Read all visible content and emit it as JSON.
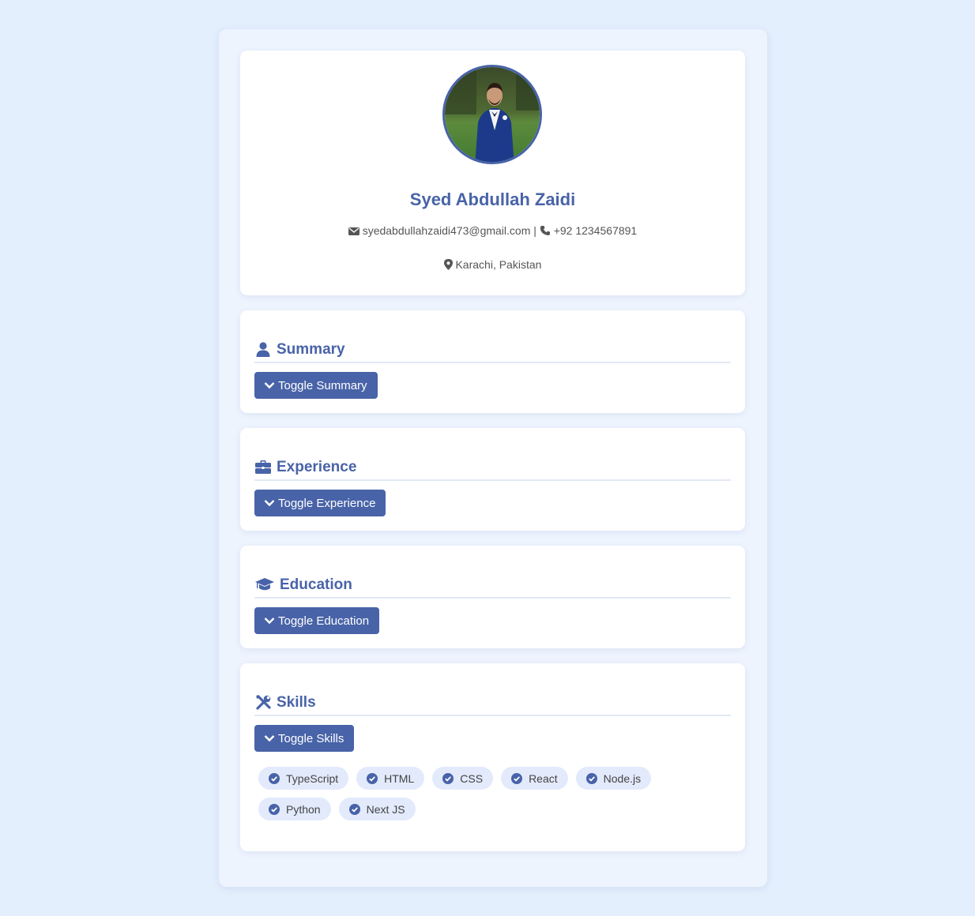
{
  "profile": {
    "name": "Syed Abdullah Zaidi",
    "email": "syedabdullahzaidi473@gmail.com",
    "separator": "|",
    "phone": "+92 1234567891",
    "location": "Karachi, Pakistan"
  },
  "sections": {
    "summary": {
      "title": "Summary",
      "toggle_label": "Toggle Summary",
      "icon": "user-icon"
    },
    "experience": {
      "title": "Experience",
      "toggle_label": "Toggle Experience",
      "icon": "briefcase-icon"
    },
    "education": {
      "title": "Education",
      "toggle_label": "Toggle Education",
      "icon": "graduation-cap-icon"
    },
    "skills": {
      "title": "Skills",
      "toggle_label": "Toggle Skills",
      "icon": "tools-icon",
      "items": [
        "TypeScript",
        "HTML",
        "CSS",
        "React",
        "Node.js",
        "Python",
        "Next JS"
      ]
    }
  },
  "colors": {
    "accent": "#4863a8",
    "page_bg": "#e4effd",
    "chip_bg": "#e2eafc"
  }
}
